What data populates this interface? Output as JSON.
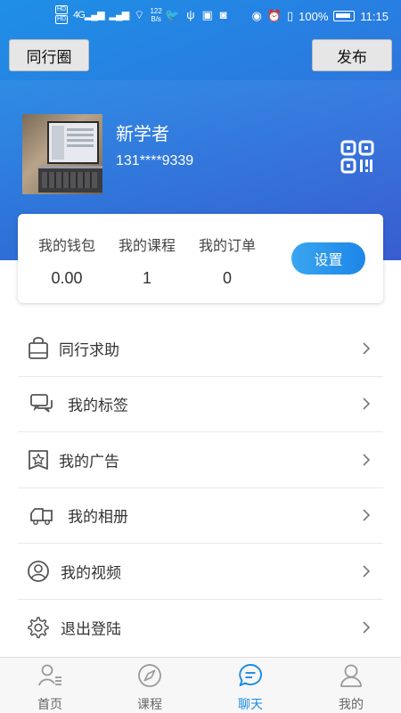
{
  "status_bar": {
    "network": "4G",
    "speed_value": "122",
    "speed_unit": "B/s",
    "battery": "100%",
    "time": "11:15"
  },
  "header": {
    "left_button": "同行圈",
    "right_button": "发布"
  },
  "profile": {
    "name": "新学者",
    "phone": "131****9339"
  },
  "stats": [
    {
      "label": "我的钱包",
      "value": "0.00"
    },
    {
      "label": "我的课程",
      "value": "1"
    },
    {
      "label": "我的订单",
      "value": "0"
    }
  ],
  "settings_button": "设置",
  "menu": [
    {
      "label": "同行求助",
      "icon": "shopping-bag-icon"
    },
    {
      "label": "我的标签",
      "icon": "chat-bubbles-icon"
    },
    {
      "label": "我的广告",
      "icon": "star-badge-icon"
    },
    {
      "label": "我的相册",
      "icon": "truck-icon"
    },
    {
      "label": "我的视频",
      "icon": "user-circle-icon"
    },
    {
      "label": "退出登陆",
      "icon": "gear-icon"
    }
  ],
  "tabs": [
    {
      "label": "首页",
      "icon": "user-list-icon",
      "active": false
    },
    {
      "label": "课程",
      "icon": "compass-icon",
      "active": false
    },
    {
      "label": "聊天",
      "icon": "chat-icon",
      "active": true
    },
    {
      "label": "我的",
      "icon": "person-icon",
      "active": false
    }
  ],
  "colors": {
    "accent": "#1a8be5",
    "header_gradient_start": "#1e8fe6",
    "header_gradient_end": "#3a5fd6"
  }
}
